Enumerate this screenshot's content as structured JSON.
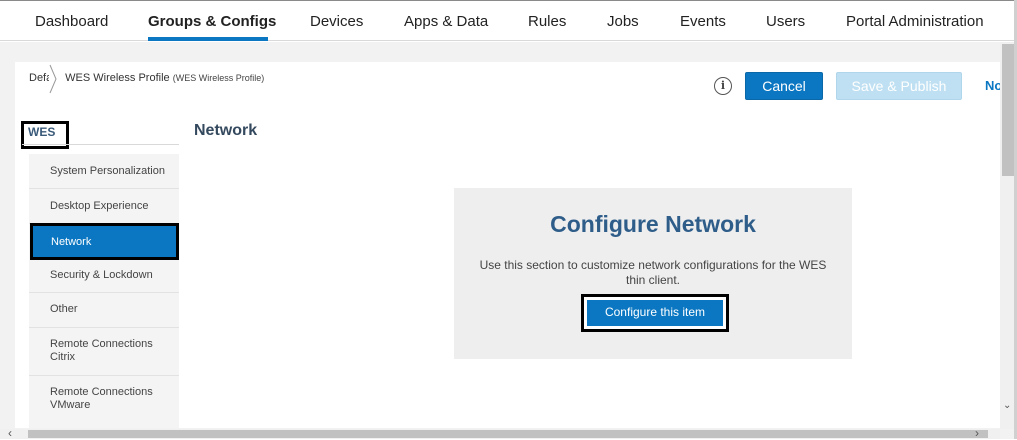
{
  "nav": {
    "tabs": [
      {
        "label": "Dashboard"
      },
      {
        "label": "Groups & Configs"
      },
      {
        "label": "Devices"
      },
      {
        "label": "Apps & Data"
      },
      {
        "label": "Rules"
      },
      {
        "label": "Jobs"
      },
      {
        "label": "Events"
      },
      {
        "label": "Users"
      },
      {
        "label": "Portal Administration"
      }
    ],
    "active_tab": "Groups & Configs"
  },
  "breadcrumb": {
    "root": "Defa",
    "current": "WES Wireless Profile",
    "current_sub": "(WES Wireless Profile)"
  },
  "toolbar": {
    "info_icon": "i",
    "cancel_label": "Cancel",
    "save_label": "Save & Publish",
    "next_label": "No"
  },
  "sidebar": {
    "heading": "WES",
    "items": [
      {
        "label": "System Personalization"
      },
      {
        "label": "Desktop Experience"
      },
      {
        "label": "Network",
        "active": true
      },
      {
        "label": "Security & Lockdown"
      },
      {
        "label": "Other"
      },
      {
        "label": "Remote Connections Citrix"
      },
      {
        "label": "Remote Connections VMware"
      }
    ]
  },
  "main": {
    "section_title": "Network",
    "card": {
      "title": "Configure Network",
      "description": "Use this section to customize network configurations for the WES thin client.",
      "button_label": "Configure this item"
    }
  },
  "colors": {
    "accent": "#0b77c2",
    "title": "#2f5d8a"
  }
}
